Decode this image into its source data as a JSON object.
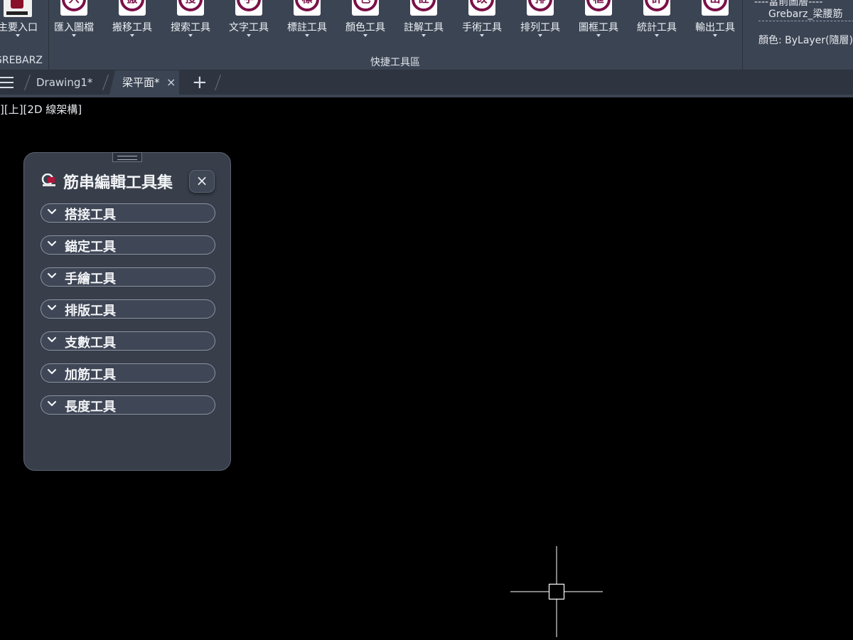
{
  "ribbon": {
    "main_group": {
      "label": "主要入口",
      "caption": "GREBARZ"
    },
    "quick_group": {
      "caption": "快捷工具區",
      "tools": [
        {
          "label": "匯入圖檔",
          "glyph": "入"
        },
        {
          "label": "搬移工具",
          "glyph": "搬"
        },
        {
          "label": "搜索工具",
          "glyph": "搜"
        },
        {
          "label": "文字工具",
          "glyph": "字"
        },
        {
          "label": "標註工具",
          "glyph": "標"
        },
        {
          "label": "顏色工具",
          "glyph": "色"
        },
        {
          "label": "註解工具",
          "glyph": "註"
        },
        {
          "label": "手術工具",
          "glyph": "改"
        },
        {
          "label": "排列工具",
          "glyph": "排"
        },
        {
          "label": "圖框工具",
          "glyph": "框"
        },
        {
          "label": "統計工具",
          "glyph": "計"
        },
        {
          "label": "輸出工具",
          "glyph": "出"
        }
      ]
    },
    "layer_group": {
      "line1": "----當前圖層----",
      "line2": "Grebarz_梁腰筋",
      "line3": "顏色: ByLayer(隨層)"
    }
  },
  "tabs": {
    "items": [
      {
        "label": "Drawing1*"
      },
      {
        "label": "梁平面*"
      }
    ],
    "close_symbol": "×",
    "add_symbol": "+"
  },
  "viewport_label": "][上][2D 線架構]",
  "palette": {
    "title": "筋串編輯工具集",
    "close_symbol": "×",
    "sections": [
      {
        "label": "搭接工具"
      },
      {
        "label": "錨定工具"
      },
      {
        "label": "手繪工具"
      },
      {
        "label": "排版工具"
      },
      {
        "label": "支數工具"
      },
      {
        "label": "加筋工具"
      },
      {
        "label": "長度工具"
      }
    ]
  },
  "colors": {
    "ribbon_bg": "#3b4453",
    "icon_accent": "#7a1048",
    "canvas_bg": "#000000",
    "palette_bg": "#383e4a"
  }
}
